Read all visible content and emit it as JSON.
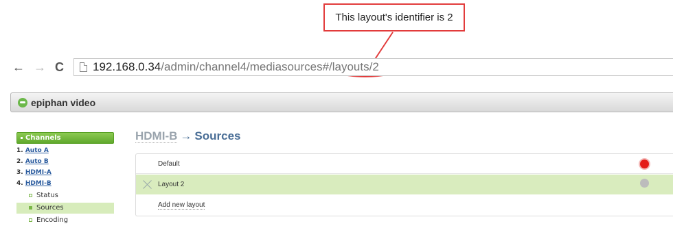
{
  "callout": {
    "text": "This layout's identifier is 2",
    "color": "#e23b3b"
  },
  "browser": {
    "back_glyph": "←",
    "forward_glyph": "→",
    "reload_glyph": "C",
    "url_host": "192.168.0.34",
    "url_path": "/admin/channel4/mediasources#/layouts/2"
  },
  "brand": {
    "name": "epiphan video",
    "color": "#6cb84a"
  },
  "sidebar": {
    "header": "Channels",
    "channels": [
      {
        "num": "1.",
        "label": "Auto A"
      },
      {
        "num": "2.",
        "label": "Auto B"
      },
      {
        "num": "3.",
        "label": "HDMI-A"
      },
      {
        "num": "4.",
        "label": "HDMI-B"
      }
    ],
    "subitems": [
      {
        "label": "Status"
      },
      {
        "label": "Sources"
      },
      {
        "label": "Encoding"
      }
    ]
  },
  "main": {
    "channel": "HDMI-B",
    "arrow": "→",
    "section": "Sources",
    "rows": [
      {
        "label": "Default",
        "status": "active",
        "status_color": "#e41b17"
      },
      {
        "label": "Layout 2",
        "status": "inactive",
        "status_color": "#bcbcbc"
      },
      {
        "label": "Add new layout"
      }
    ]
  }
}
